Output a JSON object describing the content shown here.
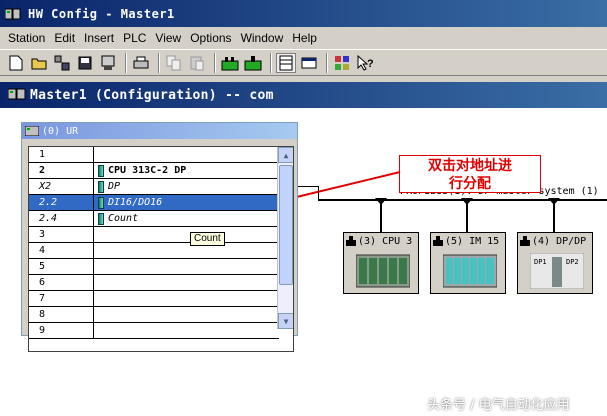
{
  "window": {
    "title": "HW Config - Master1"
  },
  "menu": [
    "Station",
    "Edit",
    "Insert",
    "PLC",
    "View",
    "Options",
    "Window",
    "Help"
  ],
  "toolbar": {
    "icons": [
      "new-icon",
      "open-icon",
      "save-network-icon",
      "save-icon",
      "download-icon",
      "print-icon",
      "copy-icon",
      "paste-icon",
      "catalog-icon",
      "network-icon",
      "rack-icon",
      "table-icon",
      "properties-icon",
      "help-pointer-icon"
    ]
  },
  "child_window": {
    "title": "Master1 (Configuration) -- com"
  },
  "rack": {
    "title": "(0) UR",
    "rows": [
      {
        "slot": "1",
        "module": ""
      },
      {
        "slot": "2",
        "module": "CPU 313C-2 DP"
      },
      {
        "slot": "X2",
        "module": "DP"
      },
      {
        "slot": "2.2",
        "module": "DI16/DO16"
      },
      {
        "slot": "2.4",
        "module": "Count"
      },
      {
        "slot": "3",
        "module": ""
      },
      {
        "slot": "4",
        "module": ""
      },
      {
        "slot": "5",
        "module": ""
      },
      {
        "slot": "6",
        "module": ""
      },
      {
        "slot": "7",
        "module": ""
      },
      {
        "slot": "8",
        "module": ""
      },
      {
        "slot": "9",
        "module": ""
      }
    ],
    "tooltip": "Count"
  },
  "network": {
    "bus_label": "PROFIBUS(1): DP master system (1)",
    "callout": "双击对地址进行分配",
    "callout_line1": "双击对地址进",
    "callout_line2": "行分配",
    "stations": [
      {
        "label": "(3) CPU 3"
      },
      {
        "label": "(5) IM 15"
      },
      {
        "label": "(4) DP/DP"
      }
    ]
  },
  "watermark": "头条号 / 电气自动化应用",
  "colors": {
    "callout": "#e00000",
    "selection": "#316ac5",
    "titlebar": "#0a246a"
  }
}
